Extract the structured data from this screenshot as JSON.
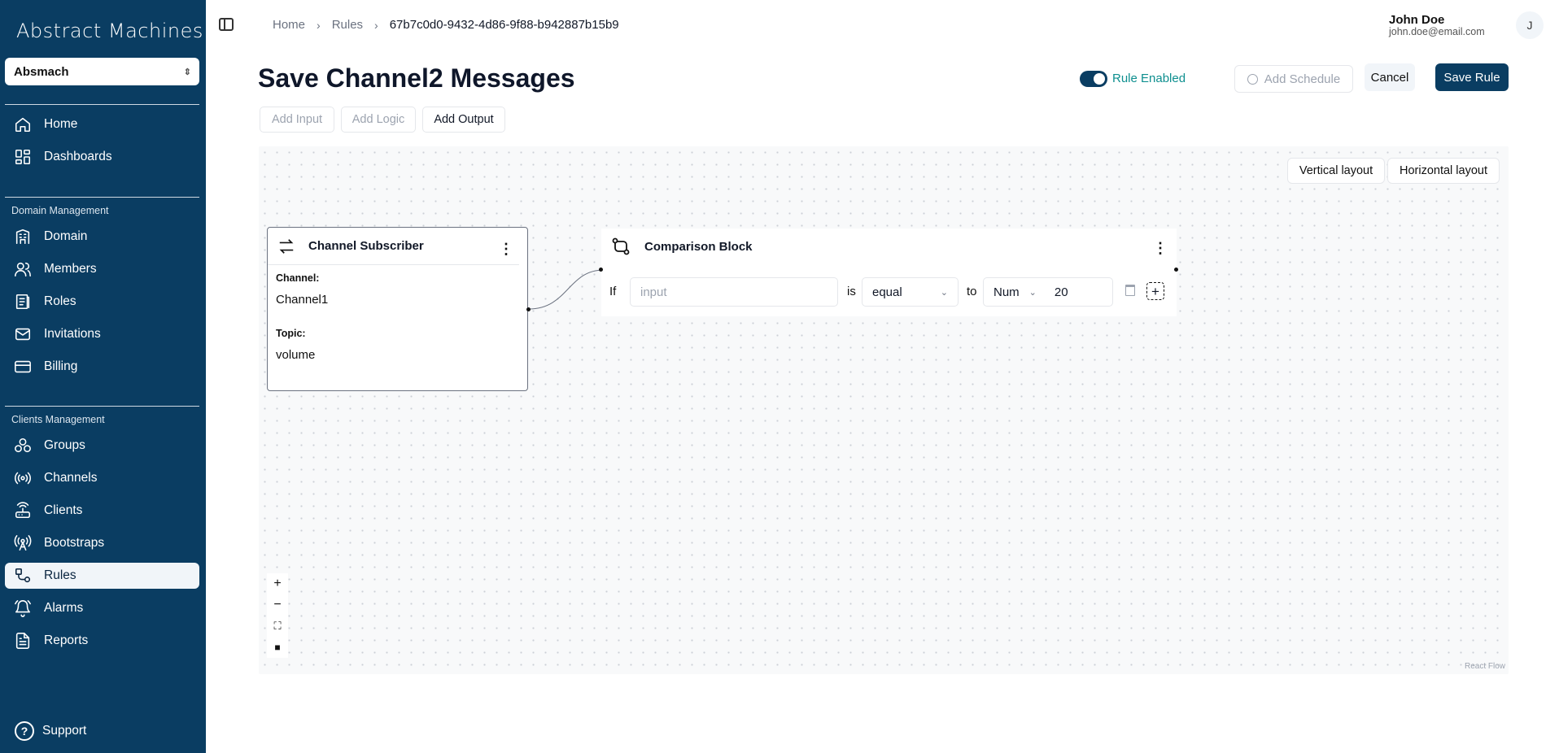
{
  "app": {
    "logo": "Abstract Machines",
    "org": "Absmach"
  },
  "sidebar": {
    "main_items": [
      {
        "label": "Home",
        "icon": "home-icon"
      },
      {
        "label": "Dashboards",
        "icon": "dashboard-icon"
      }
    ],
    "domain_section": "Domain Management",
    "domain_items": [
      {
        "label": "Domain",
        "icon": "building-icon"
      },
      {
        "label": "Members",
        "icon": "users-icon"
      },
      {
        "label": "Roles",
        "icon": "roles-icon"
      },
      {
        "label": "Invitations",
        "icon": "mail-icon"
      },
      {
        "label": "Billing",
        "icon": "credit-card-icon"
      }
    ],
    "clients_section": "Clients Management",
    "clients_items": [
      {
        "label": "Groups",
        "icon": "groups-icon"
      },
      {
        "label": "Channels",
        "icon": "radio-icon"
      },
      {
        "label": "Clients",
        "icon": "router-icon"
      },
      {
        "label": "Bootstraps",
        "icon": "antenna-icon"
      },
      {
        "label": "Rules",
        "icon": "workflow-icon",
        "active": true
      },
      {
        "label": "Alarms",
        "icon": "bell-icon"
      },
      {
        "label": "Reports",
        "icon": "file-text-icon"
      }
    ],
    "support": "Support"
  },
  "breadcrumb": [
    "Home",
    "Rules",
    "67b7c0d0-9432-4d86-9f88-b942887b15b9"
  ],
  "user": {
    "name": "John Doe",
    "email": "john.doe@email.com",
    "initial": "J"
  },
  "page": {
    "title": "Save Channel2 Messages",
    "rule_enabled_label": "Rule Enabled",
    "rule_enabled": true,
    "add_schedule": "Add Schedule",
    "cancel": "Cancel",
    "save": "Save Rule"
  },
  "toolbar": {
    "add_input": "Add Input",
    "add_logic": "Add Logic",
    "add_output": "Add Output"
  },
  "canvas": {
    "vertical_layout": "Vertical layout",
    "horizontal_layout": "Horizontal layout",
    "attribution": "React Flow",
    "channel_node": {
      "title": "Channel Subscriber",
      "channel_label": "Channel:",
      "channel_value": "Channel1",
      "topic_label": "Topic:",
      "topic_value": "volume"
    },
    "comparison_node": {
      "title": "Comparison Block",
      "if": "If",
      "input_placeholder": "input",
      "is": "is",
      "operator": "equal",
      "to": "to",
      "type": "Num",
      "value": "20"
    }
  },
  "colors": {
    "sidebar": "#0a3d62",
    "accent_teal": "#0e8f8f",
    "primary": "#0a3d62"
  }
}
